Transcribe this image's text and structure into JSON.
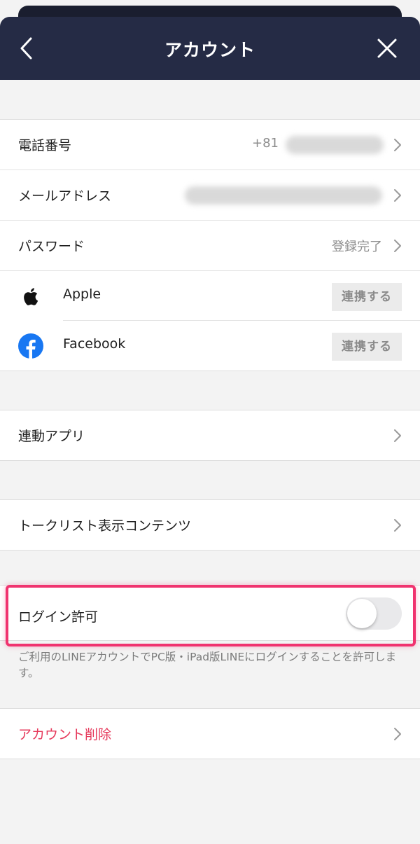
{
  "header": {
    "title": "アカウント",
    "back_icon": "chevron-left-icon",
    "close_icon": "close-icon"
  },
  "account_group": {
    "phone": {
      "label": "電話番号",
      "value_prefix": "+81"
    },
    "email": {
      "label": "メールアドレス"
    },
    "password": {
      "label": "パスワード",
      "status": "登録完了"
    },
    "apple": {
      "label": "Apple",
      "icon": "apple-logo-icon",
      "button": "連携する"
    },
    "facebook": {
      "label": "Facebook",
      "icon": "facebook-logo-icon",
      "button": "連携する",
      "brand_color": "#1877f2"
    }
  },
  "linked_apps": {
    "label": "連動アプリ"
  },
  "talk_list": {
    "label": "トークリスト表示コンテンツ"
  },
  "login_permission": {
    "label": "ログイン許可",
    "enabled": false,
    "note": "ご利用のLINEアカウントでPC版・iPad版LINEにログインすることを許可します。",
    "highlight_color": "#f0336f"
  },
  "delete_account": {
    "label": "アカウント削除",
    "color": "#e6395b"
  },
  "colors": {
    "header_bg": "#252b45",
    "background": "#f3f3f3"
  }
}
